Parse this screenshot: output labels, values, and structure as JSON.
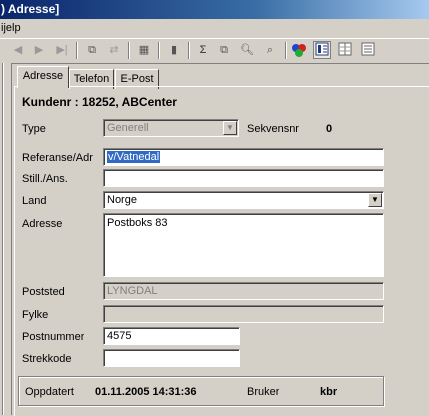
{
  "window": {
    "title": ") Adresse]"
  },
  "menu": {
    "item": "Hjelp",
    "item_visible": "ijelp"
  },
  "toolbar": {
    "icons": [
      "prev-icon",
      "next-icon",
      "last-icon",
      "cut-record-icon",
      "paste-record-icon",
      "grid-icon",
      "chart-icon",
      "sum-icon",
      "copy-icon",
      "find-icon",
      "find-next-icon",
      "palette-icon",
      "form-view-icon",
      "list-view-icon",
      "detail-view-icon"
    ]
  },
  "tabs": [
    {
      "label": "Adresse",
      "active": true
    },
    {
      "label": "Telefon",
      "active": false
    },
    {
      "label": "E-Post",
      "active": false
    }
  ],
  "header": {
    "customer": "Kundenr : 18252, ABCenter"
  },
  "form": {
    "type_label": "Type",
    "type_value": "Generell",
    "seq_label": "Sekvensnr",
    "seq_value": "0",
    "ref_label": "Referanse/Adr",
    "ref_value": "v/Vatnedal",
    "still_label": "Still./Ans.",
    "still_value": "",
    "country_label": "Land",
    "country_value": "Norge",
    "address_label": "Adresse",
    "address_value": "Postboks 83",
    "city_label": "Poststed",
    "city_value": "LYNGDAL",
    "county_label": "Fylke",
    "county_value": "",
    "postal_label": "Postnummer",
    "postal_value": "4575",
    "barcode_label": "Strekkode",
    "barcode_value": ""
  },
  "status": {
    "updated_label": "Oppdatert",
    "updated_value": "01.11.2005 14:31:36",
    "user_label": "Bruker",
    "user_value": "kbr"
  }
}
